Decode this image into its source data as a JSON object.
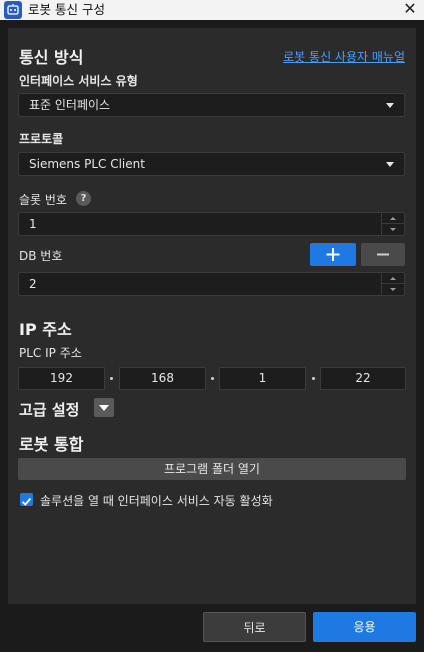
{
  "window": {
    "title": "로봇 통신 구성",
    "close_symbol": "✕"
  },
  "comm": {
    "heading": "통신 방식",
    "manual_link": "로봇 통신 사용자 매뉴얼",
    "interface_label": "인터페이스 서비스 유형",
    "interface_value": "표준 인터페이스",
    "protocol_label": "프로토콜",
    "protocol_value": "Siemens PLC Client",
    "slot_label": "슬롯 번호",
    "help_symbol": "?",
    "slot_value": "1",
    "db_label": "DB 번호",
    "db_value": "2"
  },
  "ip": {
    "heading": "IP 주소",
    "plc_label": "PLC IP 주소",
    "octets": [
      "192",
      "168",
      "1",
      "22"
    ]
  },
  "advanced": {
    "label": "고급 설정"
  },
  "integration": {
    "heading": "로봇 통합",
    "open_folder": "프로그램 폴더 열기",
    "auto_enable_label": "솔루션을 열 때 인터페이스 서비스 자동 활성화",
    "auto_enable_checked": true
  },
  "footer": {
    "back": "뒤로",
    "apply": "응용"
  },
  "colors": {
    "accent": "#1e7ae0",
    "link": "#4a9eff",
    "panel": "#2b2b2b",
    "background": "#1b1b1b"
  }
}
